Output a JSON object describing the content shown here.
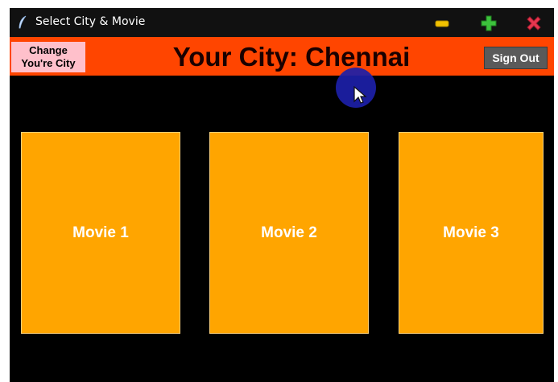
{
  "window": {
    "title": "Select City & Movie",
    "controls": {
      "minimize_icon": "minimize-icon",
      "maximize_icon": "plus-icon",
      "close_icon": "close-icon"
    }
  },
  "header": {
    "change_city_label": "Change\nYou're City",
    "city_title": "Your City: Chennai",
    "sign_out_label": "Sign Out",
    "background_color": "#ff4500"
  },
  "movies": [
    {
      "label": "Movie 1"
    },
    {
      "label": "Movie 2"
    },
    {
      "label": "Movie 3"
    }
  ],
  "colors": {
    "movie_tile": "#ffa500",
    "change_city_button": "#ffc0cb",
    "sign_out_button": "#5a5a5a",
    "cursor_halo": "#1c1fa8"
  }
}
